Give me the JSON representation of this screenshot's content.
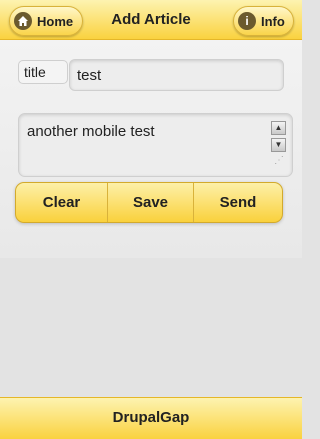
{
  "header": {
    "title": "Add Article",
    "home_label": "Home",
    "info_label": "Info",
    "home_icon": "home-icon",
    "info_icon": "info-icon"
  },
  "form": {
    "title_label": "title",
    "title_value": "test",
    "body_value": "another mobile test"
  },
  "actions": {
    "clear": "Clear",
    "save": "Save",
    "send": "Send"
  },
  "footer": {
    "text": "DrupalGap"
  },
  "colors": {
    "bar_yellow": "#fad23f",
    "background": "#e3e3e3"
  }
}
